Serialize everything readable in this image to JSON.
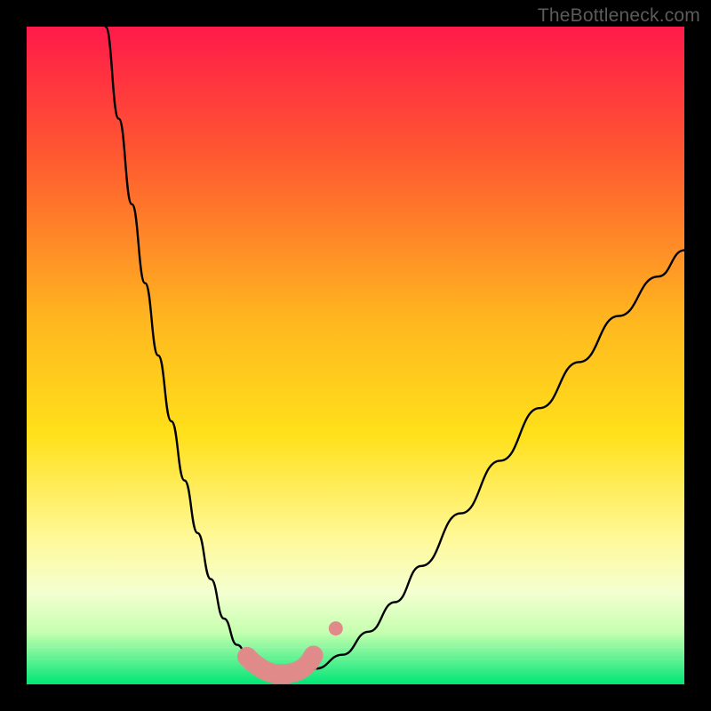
{
  "watermark": "TheBottleneck.com",
  "colors": {
    "frame": "#000000",
    "gradient_top": "#ff1a4a",
    "gradient_upper_mid": "#ff6a2a",
    "gradient_mid": "#ffd61a",
    "gradient_lower_mid": "#fff99a",
    "gradient_band": "#f8ffd0",
    "gradient_bottom": "#00e676",
    "curve": "#000000",
    "marker_fill": "#e08a8a",
    "marker_stroke": "#d97d7d"
  },
  "chart_data": {
    "type": "line",
    "title": "",
    "xlabel": "",
    "ylabel": "",
    "xlim": [
      0,
      100
    ],
    "ylim": [
      0,
      100
    ],
    "series": [
      {
        "name": "left-branch",
        "x": [
          12,
          14,
          16,
          18,
          20,
          22,
          24,
          26,
          28,
          30,
          32,
          34,
          36,
          38
        ],
        "y": [
          100,
          86,
          73,
          61,
          50,
          40,
          31,
          23,
          16,
          10,
          6,
          3.5,
          2.0,
          1.5
        ]
      },
      {
        "name": "right-branch",
        "x": [
          42,
          44,
          48,
          52,
          56,
          60,
          66,
          72,
          78,
          84,
          90,
          96,
          100
        ],
        "y": [
          1.8,
          2.4,
          4.5,
          8.0,
          12.5,
          18,
          26,
          34,
          42,
          49,
          56,
          62,
          66
        ]
      },
      {
        "name": "markers-dense",
        "x": [
          33.5,
          34.3,
          35.4,
          36.2,
          37.0,
          37.8,
          38.7,
          39.6,
          40.6,
          41.4,
          42.2,
          43.0,
          43.6
        ],
        "y": [
          4.2,
          3.4,
          2.6,
          2.1,
          1.8,
          1.6,
          1.6,
          1.6,
          1.8,
          2.1,
          2.6,
          3.4,
          4.4
        ]
      },
      {
        "name": "markers-sparse",
        "x": [
          47.0
        ],
        "y": [
          8.5
        ]
      }
    ],
    "gradient_stops": [
      {
        "pct": 0,
        "color": "#ff1a4a"
      },
      {
        "pct": 20,
        "color": "#ff5a30"
      },
      {
        "pct": 45,
        "color": "#ffb81f"
      },
      {
        "pct": 62,
        "color": "#ffe01a"
      },
      {
        "pct": 78,
        "color": "#fff99a"
      },
      {
        "pct": 86,
        "color": "#f4ffd0"
      },
      {
        "pct": 92,
        "color": "#c7ffb0"
      },
      {
        "pct": 100,
        "color": "#00e676"
      }
    ]
  }
}
